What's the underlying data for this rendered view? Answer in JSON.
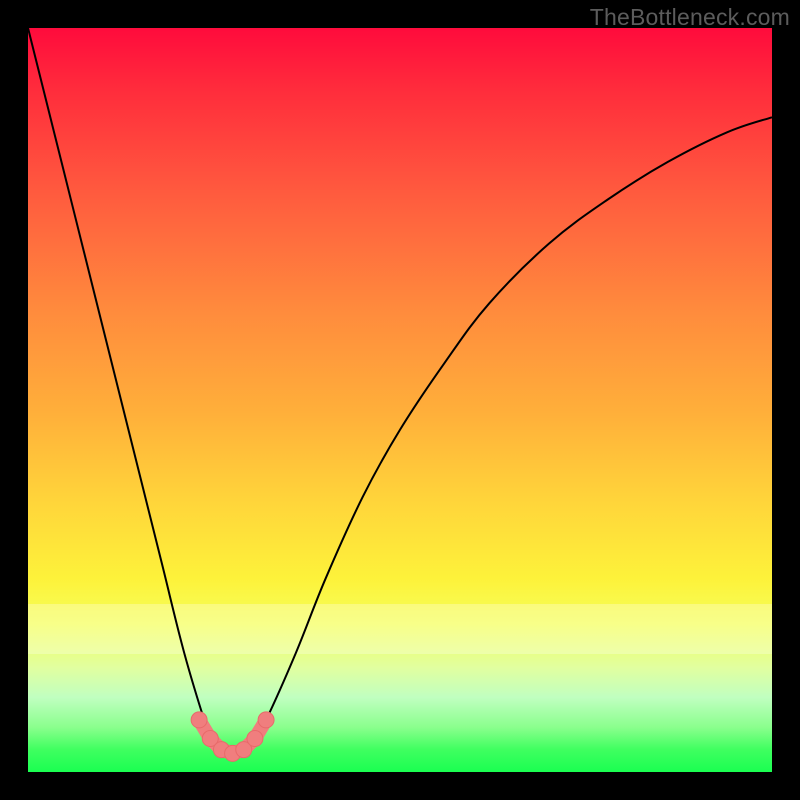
{
  "attribution": "TheBottleneck.com",
  "chart_data": {
    "type": "line",
    "title": "",
    "xlabel": "",
    "ylabel": "",
    "xlim": [
      0,
      100
    ],
    "ylim": [
      0,
      100
    ],
    "series": [
      {
        "name": "bottleneck-curve",
        "x": [
          0,
          3,
          6,
          9,
          12,
          15,
          18,
          21,
          24,
          25,
          26,
          27,
          28,
          29,
          30,
          32,
          36,
          40,
          45,
          50,
          56,
          62,
          70,
          78,
          86,
          94,
          100
        ],
        "values": [
          100,
          88,
          76,
          64,
          52,
          40,
          28,
          16,
          6,
          3.5,
          2.5,
          2,
          2,
          2.5,
          3.5,
          7,
          16,
          26,
          37,
          46,
          55,
          63,
          71,
          77,
          82,
          86,
          88
        ]
      }
    ],
    "markers": {
      "name": "highlight-dots",
      "x": [
        23.0,
        24.5,
        26.0,
        27.5,
        29.0,
        30.5,
        32.0
      ],
      "values": [
        7.0,
        4.5,
        3.0,
        2.5,
        3.0,
        4.5,
        7.0
      ]
    }
  }
}
